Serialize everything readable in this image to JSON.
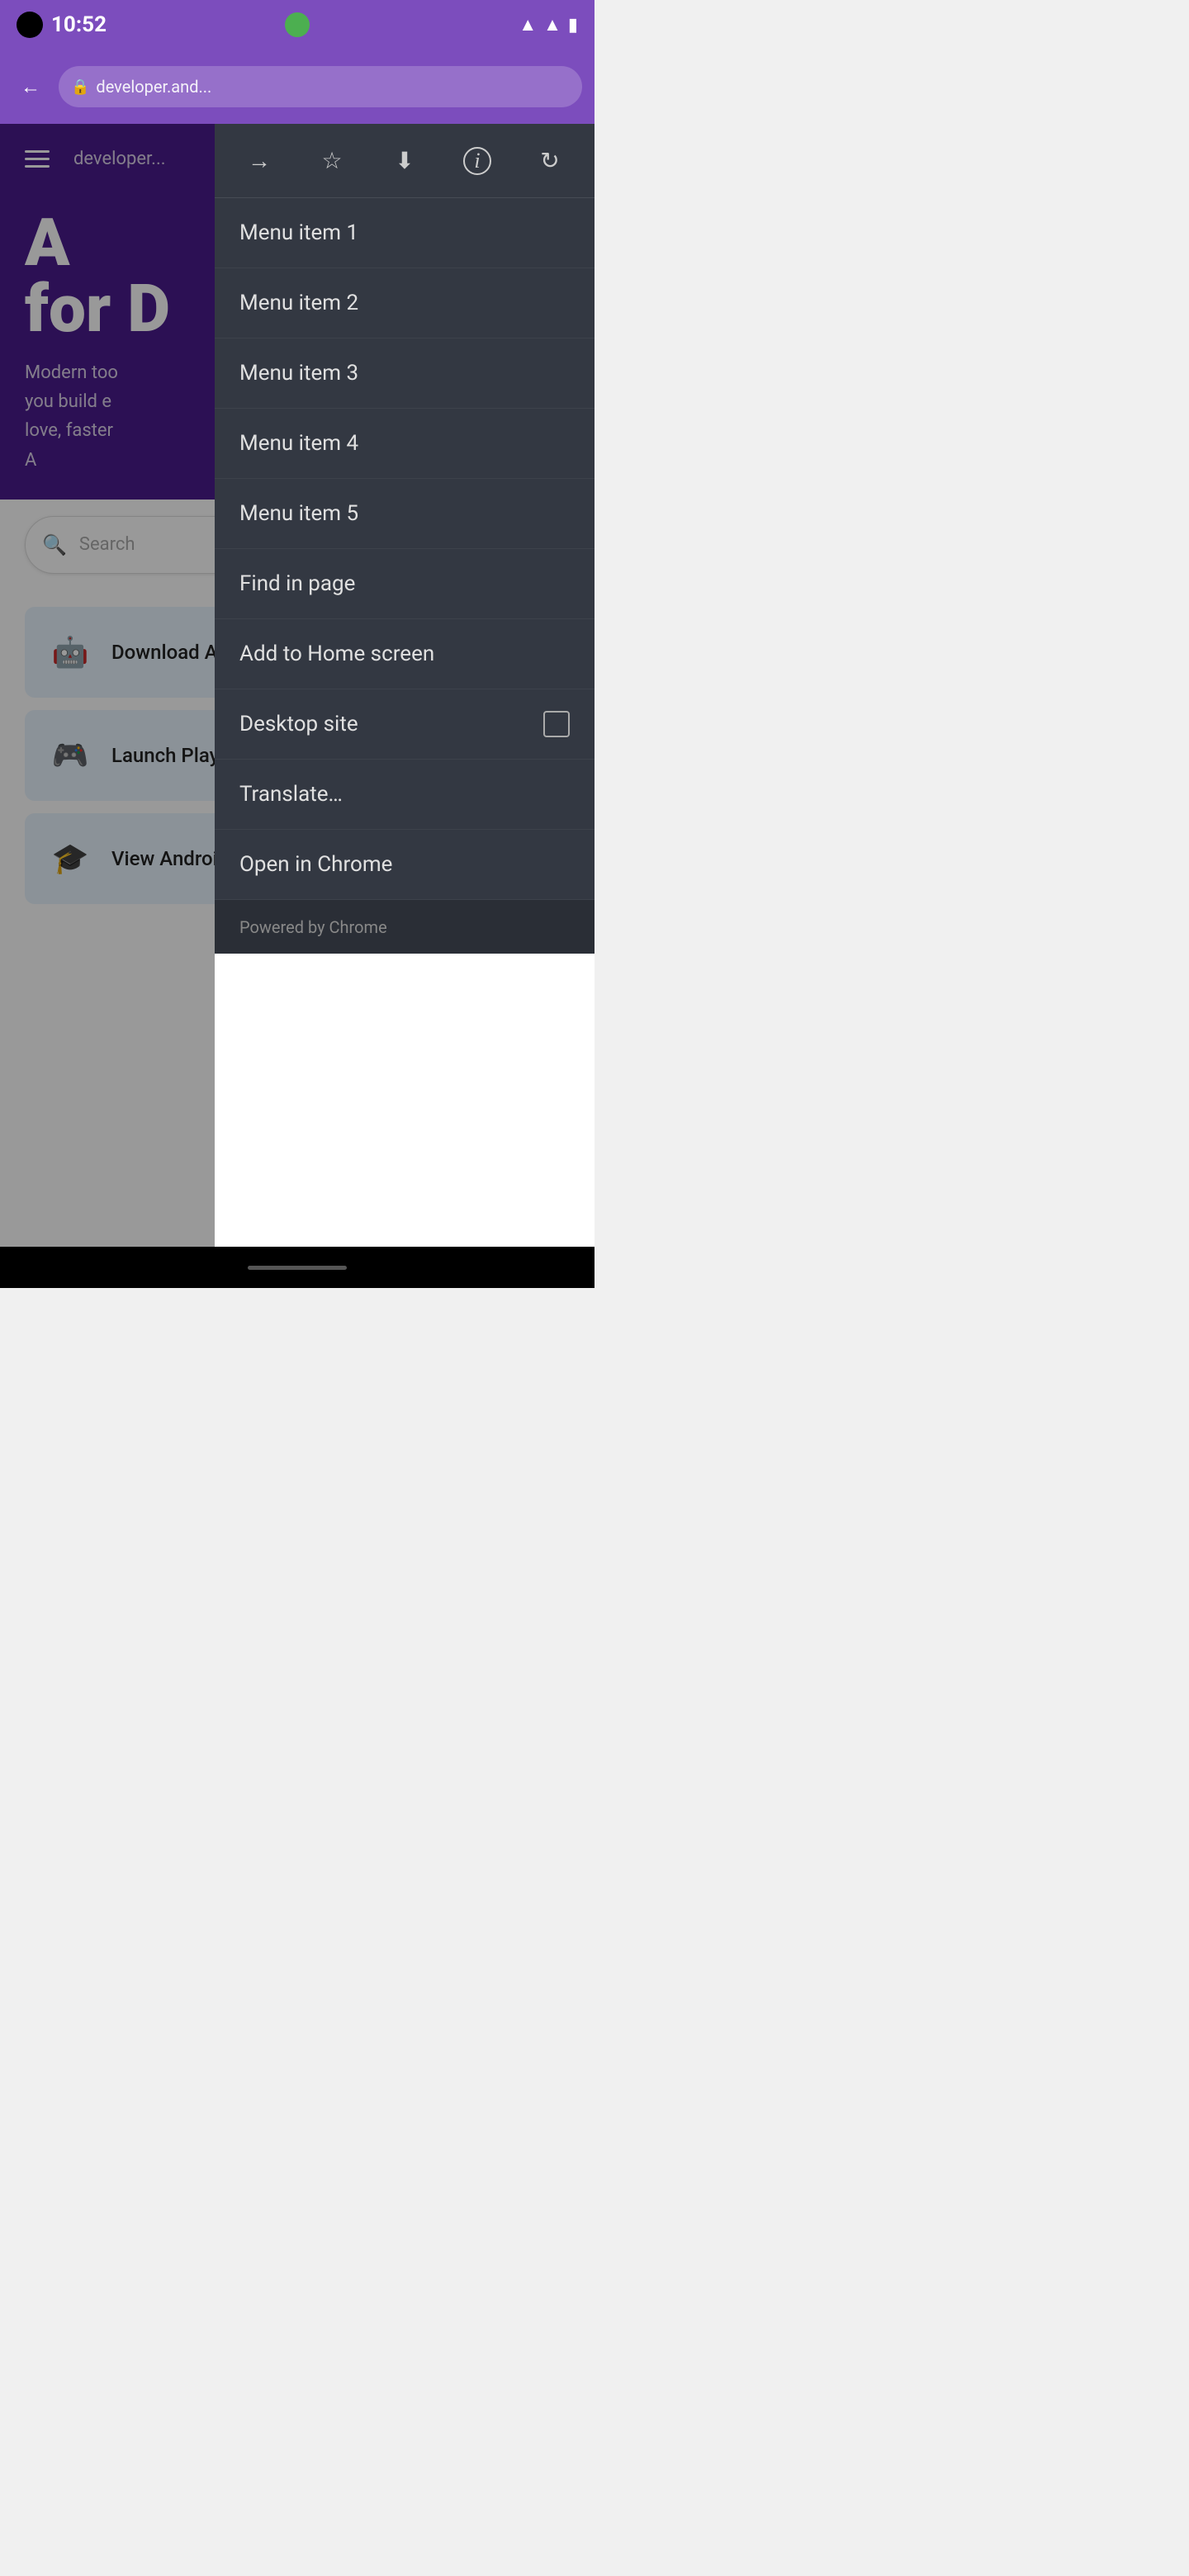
{
  "statusBar": {
    "time": "10:52",
    "centerDot": true
  },
  "browserToolbar": {
    "backLabel": "←",
    "lockLabel": "🔒",
    "urlText": "developer.and...",
    "menuLabel": "⋮"
  },
  "devPage": {
    "navUrl": "developer...",
    "heroTitle": "A\nfor D",
    "heroLine1": "Modern too",
    "heroLine2": "you build e",
    "heroLine3": "love, faster",
    "heroLine4": "A"
  },
  "searchBar": {
    "placeholder": "Search"
  },
  "cards": [
    {
      "icon": "🤖",
      "title": "Download Android Studio",
      "actionIcon": "⬇"
    },
    {
      "icon": "🎮",
      "title": "Launch Play Console",
      "actionIcon": "⧉"
    },
    {
      "icon": "🎓",
      "title": "View Android courses",
      "actionIcon": ""
    }
  ],
  "contextMenu": {
    "toolbarButtons": [
      {
        "name": "forward-icon",
        "symbol": "→"
      },
      {
        "name": "bookmark-icon",
        "symbol": "☆"
      },
      {
        "name": "download-icon",
        "symbol": "⬇"
      },
      {
        "name": "info-icon",
        "symbol": "ℹ"
      },
      {
        "name": "refresh-icon",
        "symbol": "↻"
      }
    ],
    "items": [
      {
        "name": "menu-item-1",
        "label": "Menu item 1",
        "hasCheckbox": false
      },
      {
        "name": "menu-item-2",
        "label": "Menu item 2",
        "hasCheckbox": false
      },
      {
        "name": "menu-item-3",
        "label": "Menu item 3",
        "hasCheckbox": false
      },
      {
        "name": "menu-item-4",
        "label": "Menu item 4",
        "hasCheckbox": false
      },
      {
        "name": "menu-item-5",
        "label": "Menu item 5",
        "hasCheckbox": false
      },
      {
        "name": "find-in-page",
        "label": "Find in page",
        "hasCheckbox": false
      },
      {
        "name": "add-to-home-screen",
        "label": "Add to Home screen",
        "hasCheckbox": false
      },
      {
        "name": "desktop-site",
        "label": "Desktop site",
        "hasCheckbox": true
      },
      {
        "name": "translate",
        "label": "Translate…",
        "hasCheckbox": false
      },
      {
        "name": "open-in-chrome",
        "label": "Open in Chrome",
        "hasCheckbox": false
      }
    ],
    "footer": "Powered by Chrome"
  }
}
